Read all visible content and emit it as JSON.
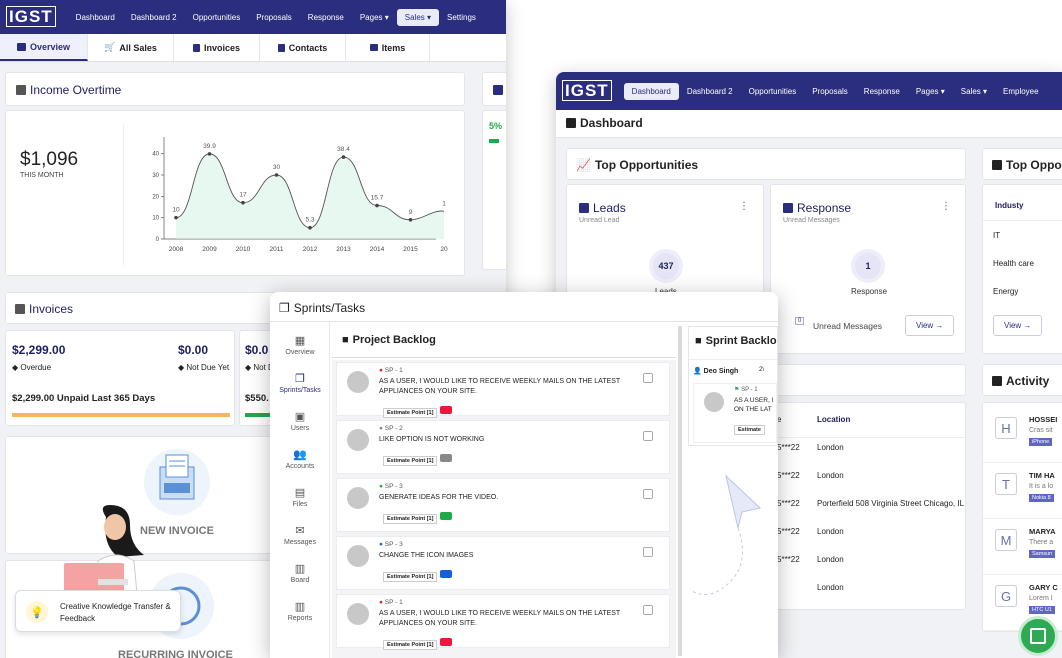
{
  "win1": {
    "logo": "IGST",
    "nav": [
      "Dashboard",
      "Dashboard 2",
      "Opportunities",
      "Proposals",
      "Response",
      "Pages ▾",
      "Sales ▾",
      "Settings"
    ],
    "tabs": [
      "Overview",
      "All Sales",
      "Invoices",
      "Contacts",
      "Items"
    ],
    "income": {
      "title": "Income Overtime",
      "amount": "$1,096",
      "sub": "THIS MONTH"
    },
    "chart_data": {
      "type": "line",
      "x": [
        "2008",
        "2009",
        "2010",
        "2011",
        "2012",
        "2013",
        "2014",
        "2015",
        "20"
      ],
      "values": [
        10,
        39.9,
        17,
        30,
        5.3,
        38.4,
        15.7,
        9,
        null
      ],
      "labels": [
        "10",
        "39.9",
        "17",
        "30",
        "5.3",
        "38.4",
        "15.7",
        "9",
        "1"
      ],
      "yticks": [
        "40",
        "30",
        "20",
        "10",
        "0"
      ],
      "ylim": [
        0,
        45
      ]
    },
    "side_pct": "5%",
    "invoices": {
      "title": "Invoices",
      "a_amount": "$2,299.00",
      "a_label": "Overdue",
      "b_amount": "$0.00",
      "b_label": "Not Due Yet",
      "c_amount": "$0.0",
      "c_label": "Not D",
      "unpaid": "$2,299.00 Unpaid Last 365 Days",
      "c2": "$550.",
      "new_invoice": "NEW INVOICE",
      "recurring": "RECURRING INVOICE"
    },
    "toast": "Creative Knowledge Transfer & Feedback"
  },
  "win2": {
    "logo": "IGST",
    "nav": [
      "Dashboard",
      "Dashboard 2",
      "Opportunities",
      "Proposals",
      "Response",
      "Pages ▾",
      "Sales ▾",
      "Employee"
    ],
    "title": "Dashboard",
    "top_opp": "Top Opportunities",
    "top_opp2": "Top Oppo",
    "leads": {
      "title": "Leads",
      "sub": "Unread Lead",
      "count": "437",
      "label": "Leads"
    },
    "response": {
      "title": "Response",
      "sub": "Unread Messages",
      "count": "1",
      "label": "Response",
      "unread_badge": "0",
      "unread": "Unread Messages",
      "view": "View →"
    },
    "industry": {
      "head": "Industy",
      "rows": [
        "IT",
        "Health care",
        "Energy"
      ],
      "view": "View →"
    },
    "location": {
      "head": "Location",
      "phones": [
        "e",
        "5***22",
        "5***22",
        "5***22",
        "5***22",
        "5***22"
      ],
      "rows": [
        "London",
        "London",
        "Porterfield 508 Virginia Street Chicago, IL",
        "London",
        "London",
        "London"
      ]
    },
    "activity": {
      "title": "Activity",
      "items": [
        {
          "init": "H",
          "name": "HOSSEI",
          "text": "Cras sit",
          "tag": "iPhone"
        },
        {
          "init": "T",
          "name": "TIM HA",
          "text": "It is a lo",
          "tag": "Nokia 8"
        },
        {
          "init": "M",
          "name": "MARYA",
          "text": "There a",
          "tag": "Samsun"
        },
        {
          "init": "G",
          "name": "GARY C",
          "text": "Lorem I",
          "tag": "HTC U1"
        }
      ]
    }
  },
  "win3": {
    "title": "Sprints/Tasks",
    "side": [
      "Overview",
      "Sprints/Tasks",
      "Users",
      "Accounts",
      "Files",
      "Messages",
      "Board",
      "Reports"
    ],
    "backlog": "Project Backlog",
    "sprint": "Sprint Backlo",
    "sprint_user": "Deo Singh",
    "sprint_date": "2\\",
    "sprint_task": {
      "id": "SP - 1",
      "text": "AS A USER, I ON THE LAT",
      "tag": "Estimate"
    },
    "tasks": [
      {
        "id": "SP - 1",
        "text": "AS A USER, I WOULD LIKE TO RECEIVE WEEKLY MAILS ON THE LATEST APPLIANCES ON YOUR SITE.",
        "tag": "Estimate Point [1]",
        "color": "#e8193c"
      },
      {
        "id": "SP - 2",
        "text": "LIKE OPTION IS NOT WORKING",
        "tag": "Estimate Point [1]",
        "color": "#888888"
      },
      {
        "id": "SP - 3",
        "text": "GENERATE IDEAS FOR THE VIDEO.",
        "tag": "Estimate Point [1]",
        "color": "#1faa4a"
      },
      {
        "id": "SP - 3",
        "text": "CHANGE THE ICON IMAGES",
        "tag": "Estimate Point [1]",
        "color": "#1560d8"
      },
      {
        "id": "SP - 1",
        "text": "AS A USER, I WOULD LIKE TO RECEIVE WEEKLY MAILS ON THE LATEST APPLIANCES ON YOUR SITE.",
        "tag": "Estimate Point [1]",
        "color": "#e8193c"
      }
    ]
  }
}
